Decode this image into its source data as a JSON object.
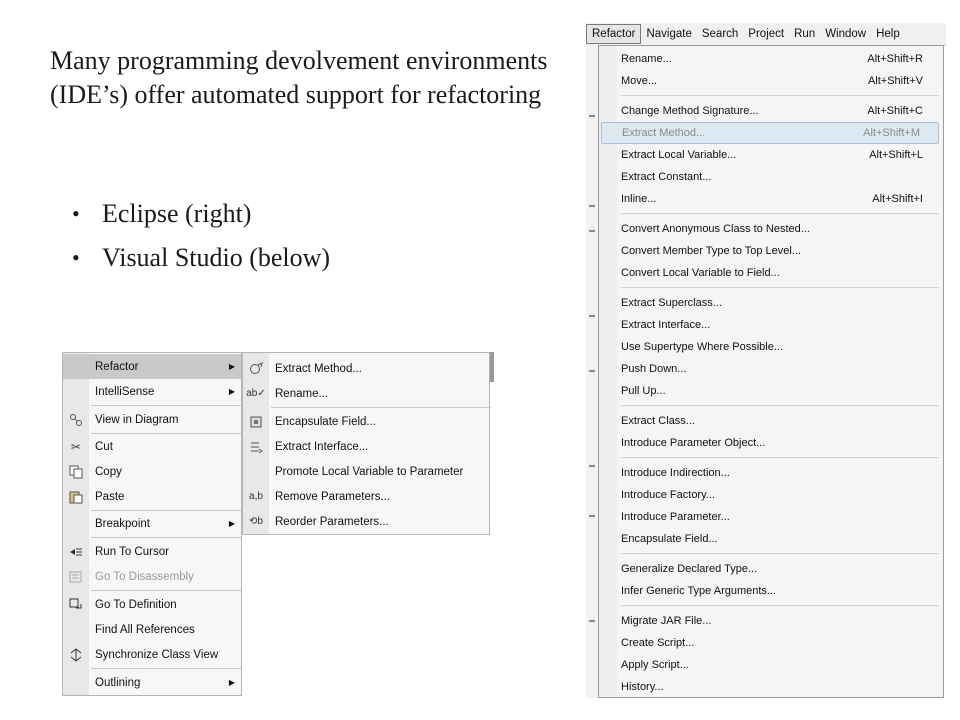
{
  "slide": {
    "intro": "Many programming devolvement environments (IDE’s) offer automated support for refactoring",
    "bullets": [
      "Eclipse (right)",
      "Visual Studio (below)"
    ]
  },
  "vs_menu": {
    "items": [
      {
        "label": "Refactor",
        "icon": "",
        "submenu": true,
        "highlighted": true,
        "disabled": false
      },
      {
        "label": "IntelliSense",
        "icon": "",
        "submenu": true,
        "highlighted": false,
        "disabled": false
      },
      {
        "label": "View in Diagram",
        "icon": "diagram-icon",
        "submenu": false,
        "highlighted": false,
        "disabled": false
      },
      {
        "label": "Cut",
        "icon": "scissors-icon",
        "submenu": false,
        "highlighted": false,
        "disabled": false
      },
      {
        "label": "Copy",
        "icon": "copy-icon",
        "submenu": false,
        "highlighted": false,
        "disabled": false
      },
      {
        "label": "Paste",
        "icon": "paste-icon",
        "submenu": false,
        "highlighted": false,
        "disabled": false
      },
      {
        "label": "Breakpoint",
        "icon": "",
        "submenu": true,
        "highlighted": false,
        "disabled": false
      },
      {
        "label": "Run To Cursor",
        "icon": "run-to-cursor-icon",
        "submenu": false,
        "highlighted": false,
        "disabled": false
      },
      {
        "label": "Go To Disassembly",
        "icon": "disassembly-icon",
        "submenu": false,
        "highlighted": false,
        "disabled": true
      },
      {
        "label": "Go To Definition",
        "icon": "go-to-definition-icon",
        "submenu": false,
        "highlighted": false,
        "disabled": false
      },
      {
        "label": "Find All References",
        "icon": "",
        "submenu": false,
        "highlighted": false,
        "disabled": false
      },
      {
        "label": "Synchronize Class View",
        "icon": "sync-icon",
        "submenu": false,
        "highlighted": false,
        "disabled": false
      },
      {
        "label": "Outlining",
        "icon": "",
        "submenu": true,
        "highlighted": false,
        "disabled": false
      }
    ],
    "submenu": [
      {
        "label": "Extract Method...",
        "icon": "extract-method-icon"
      },
      {
        "label": "Rename...",
        "icon": "rename-icon"
      },
      {
        "label": "Encapsulate Field...",
        "icon": "encapsulate-field-icon"
      },
      {
        "label": "Extract Interface...",
        "icon": "extract-interface-icon"
      },
      {
        "label": "Promote Local Variable to Parameter",
        "icon": ""
      },
      {
        "label": "Remove Parameters...",
        "icon": "remove-parameters-icon"
      },
      {
        "label": "Reorder Parameters...",
        "icon": "reorder-parameters-icon"
      }
    ]
  },
  "eclipse": {
    "menubar": [
      "Refactor",
      "Navigate",
      "Search",
      "Project",
      "Run",
      "Window",
      "Help"
    ],
    "active_menu": "Refactor",
    "items": [
      {
        "label": "Rename...",
        "shortcut": "Alt+Shift+R"
      },
      {
        "label": "Move...",
        "shortcut": "Alt+Shift+V"
      },
      {
        "label": "Change Method Signature...",
        "shortcut": "Alt+Shift+C"
      },
      {
        "label": "Extract Method...",
        "shortcut": "Alt+Shift+M",
        "highlighted": true
      },
      {
        "label": "Extract Local Variable...",
        "shortcut": "Alt+Shift+L"
      },
      {
        "label": "Extract Constant...",
        "shortcut": ""
      },
      {
        "label": "Inline...",
        "shortcut": "Alt+Shift+I"
      },
      {
        "label": "Convert Anonymous Class to Nested...",
        "shortcut": ""
      },
      {
        "label": "Convert Member Type to Top Level...",
        "shortcut": ""
      },
      {
        "label": "Convert Local Variable to Field...",
        "shortcut": ""
      },
      {
        "label": "Extract Superclass...",
        "shortcut": ""
      },
      {
        "label": "Extract Interface...",
        "shortcut": ""
      },
      {
        "label": "Use Supertype Where Possible...",
        "shortcut": ""
      },
      {
        "label": "Push Down...",
        "shortcut": ""
      },
      {
        "label": "Pull Up...",
        "shortcut": ""
      },
      {
        "label": "Extract Class...",
        "shortcut": ""
      },
      {
        "label": "Introduce Parameter Object...",
        "shortcut": ""
      },
      {
        "label": "Introduce Indirection...",
        "shortcut": ""
      },
      {
        "label": "Introduce Factory...",
        "shortcut": ""
      },
      {
        "label": "Introduce Parameter...",
        "shortcut": ""
      },
      {
        "label": "Encapsulate Field...",
        "shortcut": ""
      },
      {
        "label": "Generalize Declared Type...",
        "shortcut": ""
      },
      {
        "label": "Infer Generic Type Arguments...",
        "shortcut": ""
      },
      {
        "label": "Migrate JAR File...",
        "shortcut": ""
      },
      {
        "label": "Create Script...",
        "shortcut": ""
      },
      {
        "label": "Apply Script...",
        "shortcut": ""
      },
      {
        "label": "History...",
        "shortcut": ""
      }
    ]
  }
}
